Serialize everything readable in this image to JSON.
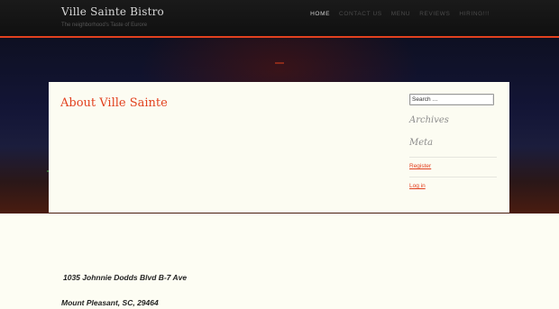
{
  "header": {
    "site_title": "Ville Sainte Bistro",
    "tagline": "The neighborhood's  Taste of Eurore",
    "nav": [
      {
        "label": "HOME",
        "active": true
      },
      {
        "label": "CONTACT US",
        "active": false
      },
      {
        "label": "MENU",
        "active": false
      },
      {
        "label": "REVIEWS",
        "active": false
      },
      {
        "label": "HIRING!!!",
        "active": false
      }
    ],
    "accent_color": "#e2411f"
  },
  "content": {
    "page_title": "About Ville Sainte"
  },
  "sidebar": {
    "search_placeholder": "Search …",
    "archives_title": "Archives",
    "meta_title": "Meta",
    "links": [
      "Register",
      "Log in"
    ]
  },
  "address": {
    "street": "1035 Johnnie Dodds Blvd B-7 Ave",
    "city": "Mount Pleasant, SC, 29464"
  }
}
